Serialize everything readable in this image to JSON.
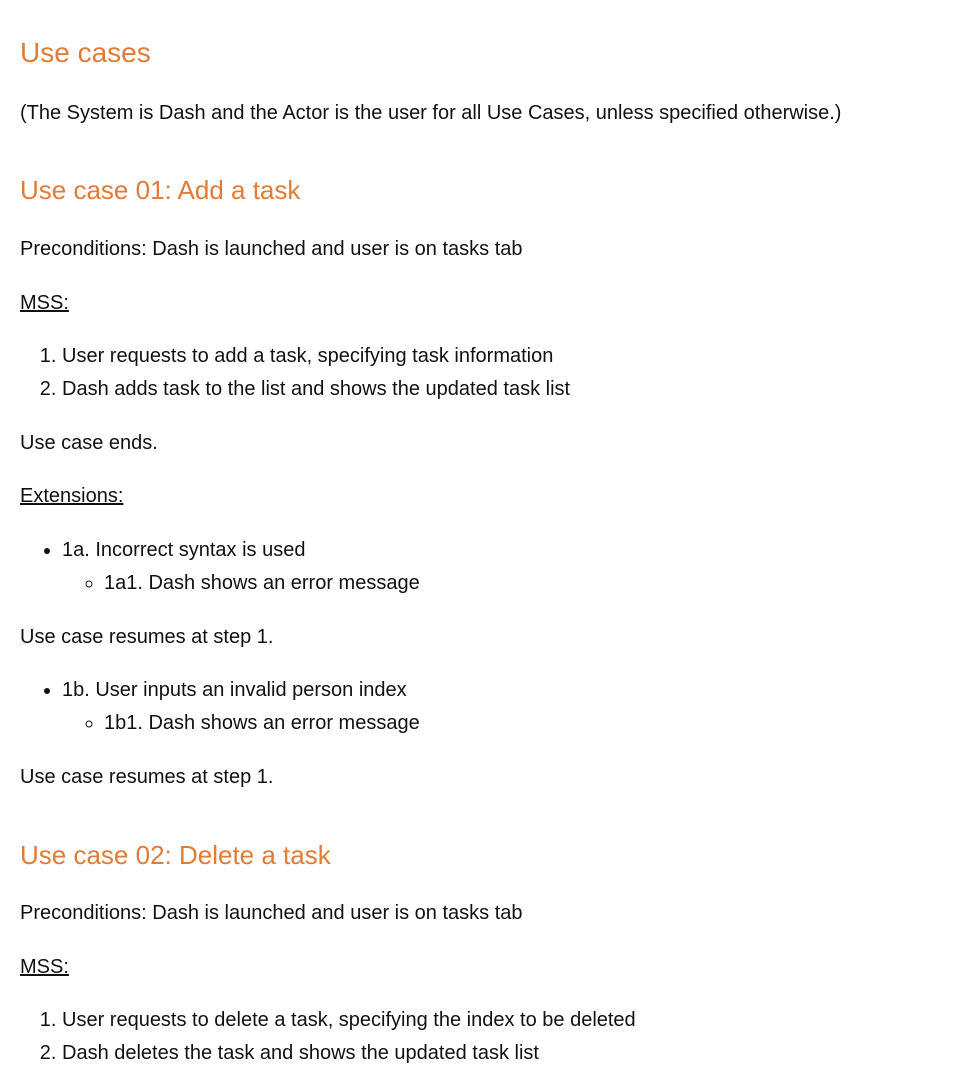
{
  "heading": "Use cases",
  "intro": "(The System is Dash and the Actor is the user for all Use Cases, unless specified otherwise.)",
  "use_cases": [
    {
      "title": "Use case 01: Add a task",
      "preconditions": "Preconditions: Dash is launched and user is on tasks tab",
      "mss_label": "MSS:",
      "mss_steps": [
        "User requests to add a task, specifying task information",
        "Dash adds task to the list and shows the updated task list"
      ],
      "ends": "Use case ends.",
      "extensions_label": "Extensions:",
      "extensions": [
        {
          "label": "1a. Incorrect syntax is used",
          "sub": "1a1. Dash shows an error message",
          "resume": "Use case resumes at step 1."
        },
        {
          "label": "1b. User inputs an invalid person index",
          "sub": "1b1. Dash shows an error message",
          "resume": "Use case resumes at step 1."
        }
      ]
    },
    {
      "title": "Use case 02: Delete a task",
      "preconditions": "Preconditions: Dash is launched and user is on tasks tab",
      "mss_label": "MSS:",
      "mss_steps": [
        "User requests to delete a task, specifying the index to be deleted",
        "Dash deletes the task and shows the updated task list"
      ]
    }
  ]
}
